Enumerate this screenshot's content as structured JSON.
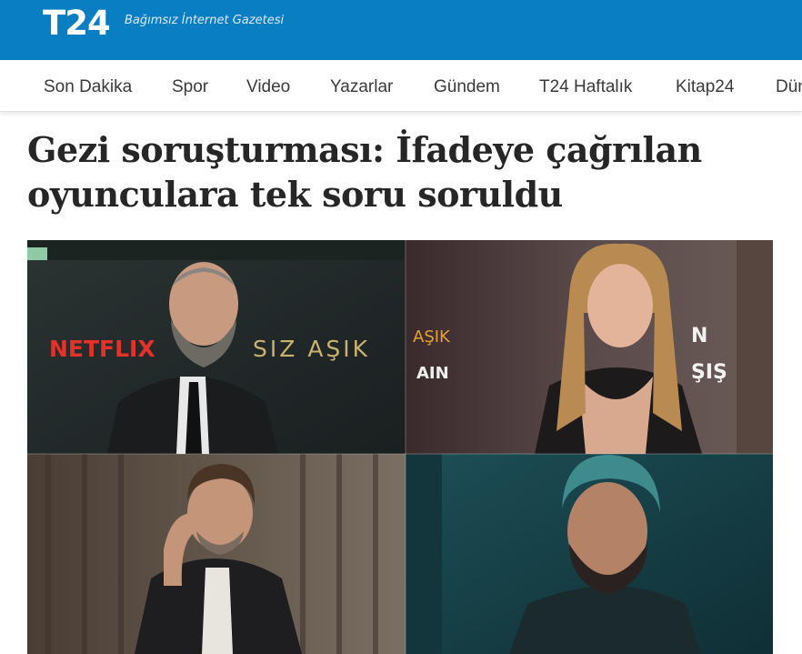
{
  "header": {
    "logo": "T24",
    "tagline": "Bağımsız İnternet Gazetesi",
    "brand_color": "#0a7ec2"
  },
  "nav": {
    "items": [
      "Son Dakika",
      "Spor",
      "Video",
      "Yazarlar",
      "Gündem",
      "T24 Haftalık",
      "Kitap24",
      "Dün"
    ]
  },
  "article": {
    "title": "Gezi soruşturması: İfadeye çağrılan oyunculara tek soru soruldu"
  },
  "photo": {
    "backdrop_text_left": "NETFLIX",
    "backdrop_text_middle": "SIZ AŞIK",
    "backdrop_text_aşık": "AŞIK",
    "backdrop_text_ain": "AIN",
    "backdrop_text_top": "AŞIK",
    "backdrop_text_right1": "N",
    "backdrop_text_right2": "ŞIŞ"
  }
}
